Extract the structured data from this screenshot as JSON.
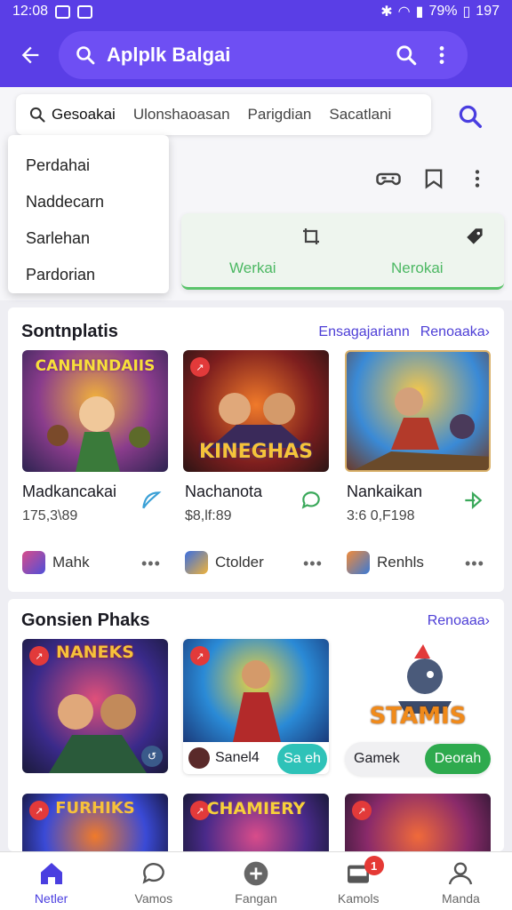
{
  "status": {
    "time": "12:08",
    "battery": "79%",
    "right_num": "197"
  },
  "appbar": {
    "title": "Aplplk Balgai"
  },
  "filters": [
    "Gesoakai",
    "Ulonshaoasan",
    "Parigdian",
    "Sacatlani"
  ],
  "dropdown": [
    "Perdahai",
    "Naddecarn",
    "Sarlehan",
    "Pardorian"
  ],
  "tabs": [
    "Werkai",
    "Nerokai"
  ],
  "section1": {
    "title": "Sontnplatis",
    "links": [
      "Ensagajariann",
      "Renoaaka›"
    ],
    "apps": [
      {
        "name": "Madkancakai",
        "meta": "175,3\\89",
        "dev": "Mahk",
        "art": "CANHNNDAIIS"
      },
      {
        "name": "Nachanota",
        "meta": "$8,lf:89",
        "dev": "Ctolder",
        "art": "KINEGHAS"
      },
      {
        "name": "Nankaikan",
        "meta": "3:6 0,F198",
        "dev": "Renhls",
        "art": ""
      }
    ]
  },
  "section2": {
    "title": "Gonsien Phaks",
    "link": "Renoaaa›",
    "cards": [
      {
        "art": "NANEKS"
      },
      {
        "label": "Sanel4",
        "pill": "Sa eh"
      },
      {
        "art": "STAMIS",
        "label": "Gamek",
        "pill": "Deorah"
      }
    ],
    "row2": [
      "FURHIKS",
      "CHAMIERY",
      ""
    ]
  },
  "nav": [
    {
      "label": "Netler",
      "icon": "home-icon"
    },
    {
      "label": "Vamos",
      "icon": "chat-icon"
    },
    {
      "label": "Fangan",
      "icon": "plus-circle-icon"
    },
    {
      "label": "Kamols",
      "icon": "inbox-icon",
      "badge": "1"
    },
    {
      "label": "Manda",
      "icon": "person-icon"
    }
  ],
  "colors": {
    "primary": "#5a3ee6",
    "accent_green": "#4cb863",
    "link": "#4d3ed6"
  }
}
